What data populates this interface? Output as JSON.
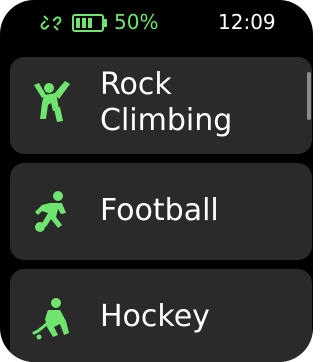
{
  "status_bar": {
    "link_icon": "link-broken-icon",
    "battery_icon": "battery-icon",
    "battery_percent": "50%",
    "time": "12:09"
  },
  "activities": [
    {
      "label": "Rock\nClimbing",
      "icon": "rock-climbing-icon"
    },
    {
      "label": "Football",
      "icon": "football-icon"
    },
    {
      "label": "Hockey",
      "icon": "hockey-icon"
    }
  ],
  "colors": {
    "accent": "#6fe56f",
    "card_bg": "#2a2a2a",
    "screen_bg": "#000000"
  }
}
